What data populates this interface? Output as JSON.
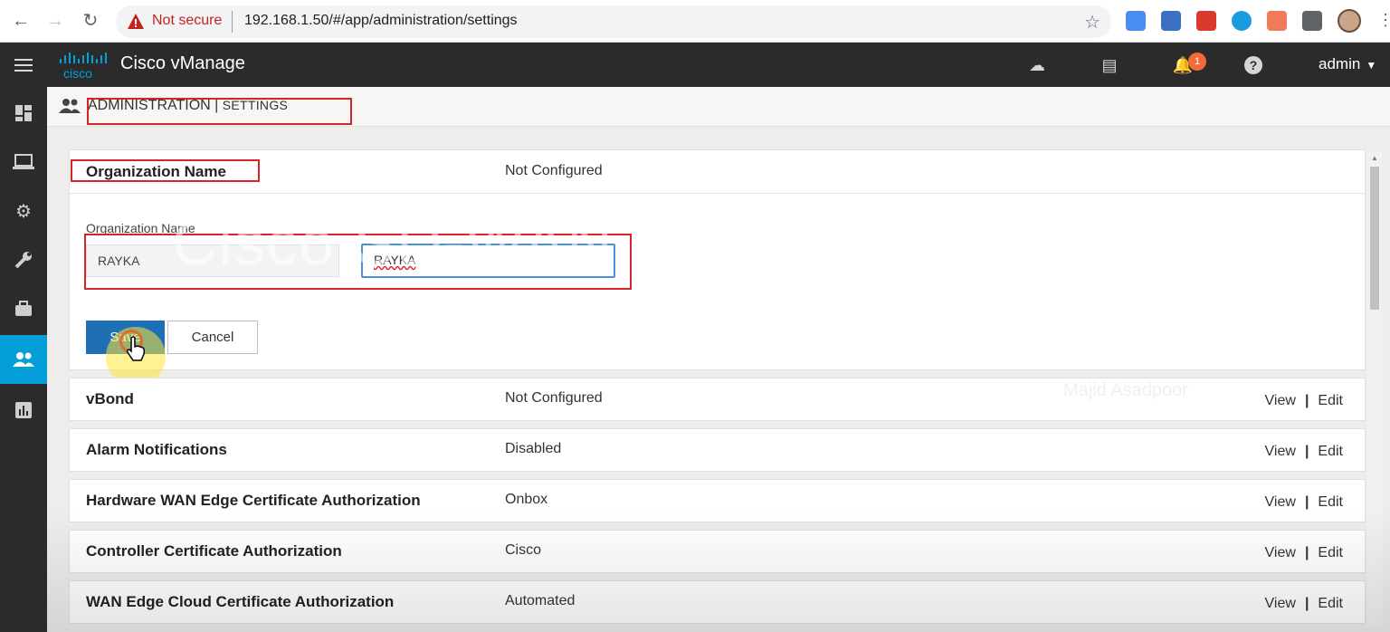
{
  "browser": {
    "security_label": "Not secure",
    "url": "192.168.1.50/#/app/administration/settings"
  },
  "header": {
    "product_name": "Cisco vManage",
    "notification_count": "1",
    "user": "admin"
  },
  "left_nav": {
    "items": [
      "dashboard-icon",
      "monitor-icon",
      "configuration-icon",
      "tools-icon",
      "maintenance-icon",
      "administration-icon",
      "analytics-icon"
    ],
    "active": "administration-icon"
  },
  "page": {
    "section": "ADMINISTRATION",
    "separator": "|",
    "subsection": "SETTINGS"
  },
  "org_card": {
    "name": "Organization Name",
    "value": "Not Configured",
    "field_label": "Organization Name",
    "readonly_value": "RAYKA",
    "edit_value": "RAYKA",
    "save_label": "Save",
    "cancel_label": "Cancel"
  },
  "settings": [
    {
      "name": "vBond",
      "value": "Not Configured",
      "view": "View",
      "edit": "Edit"
    },
    {
      "name": "Alarm Notifications",
      "value": "Disabled",
      "view": "View",
      "edit": "Edit"
    },
    {
      "name": "Hardware WAN Edge Certificate Authorization",
      "value": "Onbox",
      "view": "View",
      "edit": "Edit"
    },
    {
      "name": "Controller Certificate Authorization",
      "value": "Cisco",
      "view": "View",
      "edit": "Edit"
    },
    {
      "name": "WAN Edge Cloud Certificate Authorization",
      "value": "Automated",
      "view": "View",
      "edit": "Edit"
    }
  ],
  "action_separator": "|",
  "overlay": {
    "watermark": "Cisco SD-WAN vManage Installation",
    "author": "Majid Asadpoor"
  },
  "colors": {
    "header_bg": "#2b2b2b",
    "active_nav": "#049fd9",
    "save_button": "#1f6fb5",
    "highlight_box": "#d8232a",
    "badge": "#f26b3a"
  }
}
